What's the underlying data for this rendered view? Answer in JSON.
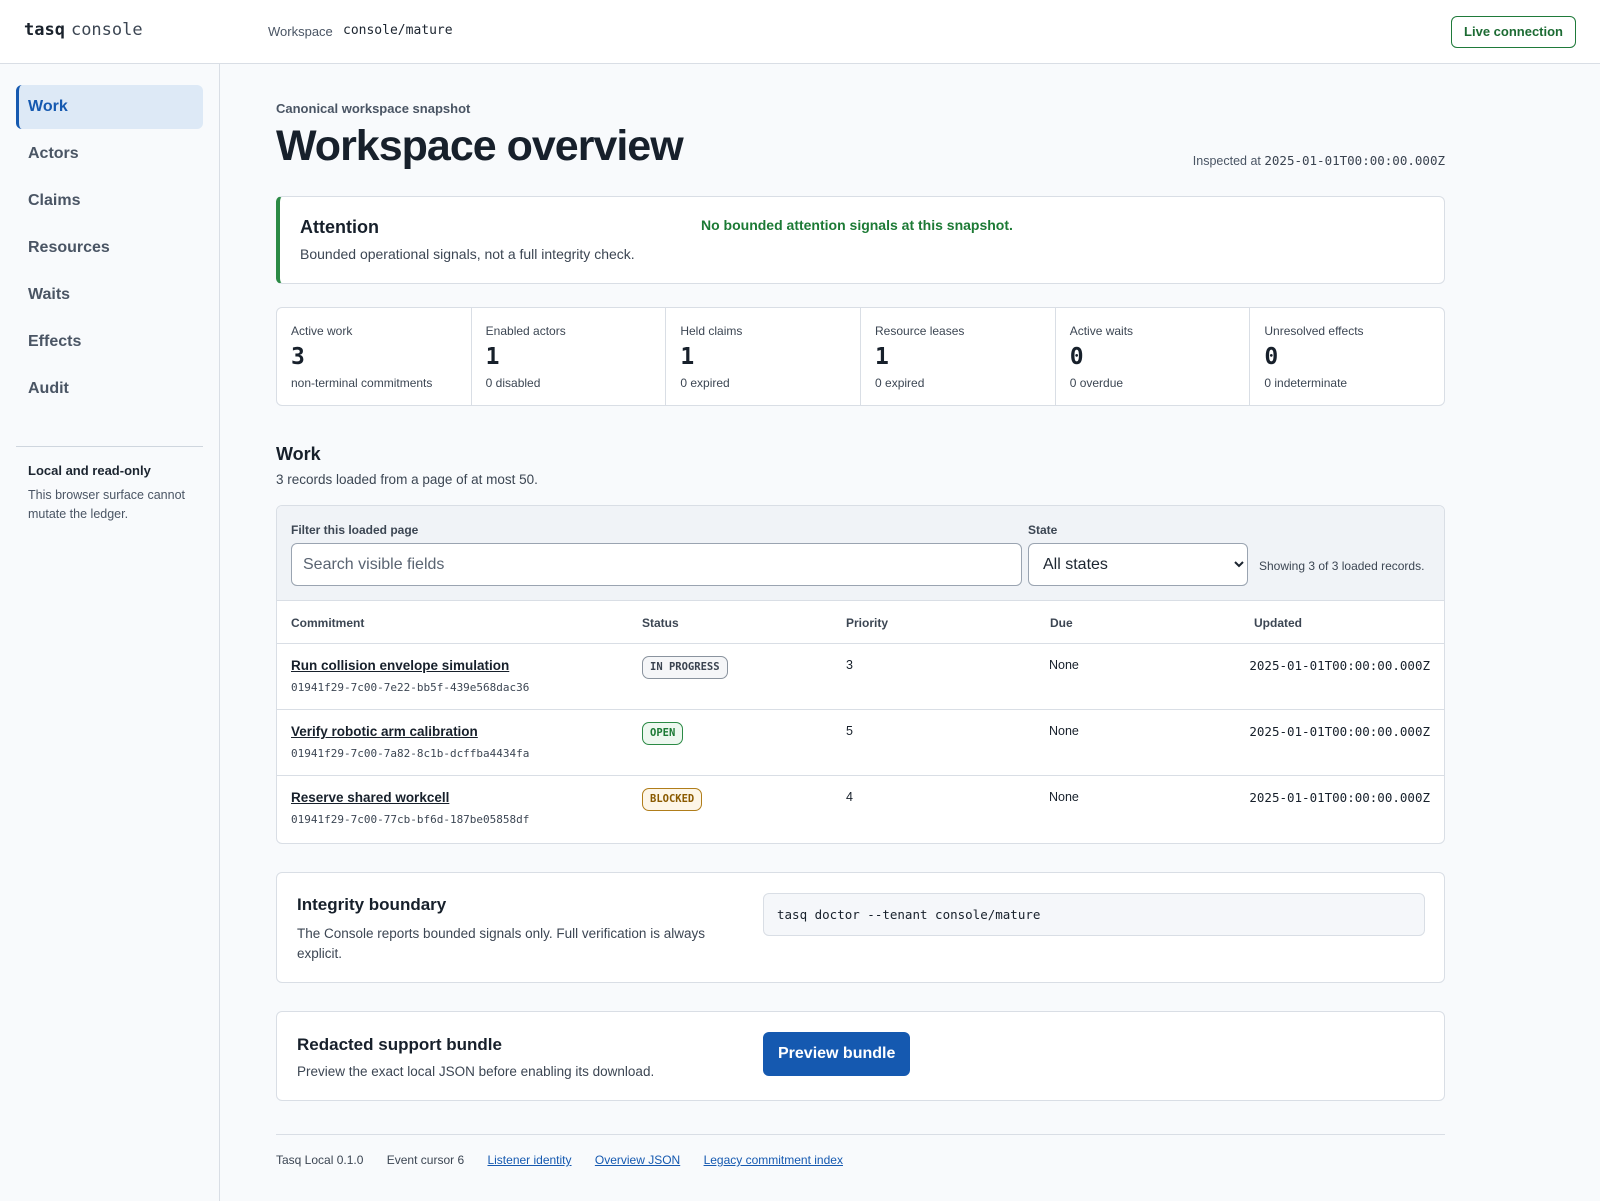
{
  "header": {
    "brand_bold": "tasq",
    "brand_rest": "console",
    "workspace_label": "Workspace",
    "workspace_value": "console/mature",
    "live_label": "Live connection"
  },
  "sidebar": {
    "items": [
      {
        "label": "Work",
        "active": true
      },
      {
        "label": "Actors"
      },
      {
        "label": "Claims"
      },
      {
        "label": "Resources"
      },
      {
        "label": "Waits"
      },
      {
        "label": "Effects"
      },
      {
        "label": "Audit"
      }
    ],
    "note_title": "Local and read-only",
    "note_text": "This browser surface cannot mutate the ledger."
  },
  "page": {
    "eyebrow": "Canonical workspace snapshot",
    "title": "Workspace overview",
    "inspected_label": "Inspected at",
    "inspected_value": "2025-01-01T00:00:00.000Z"
  },
  "attention": {
    "title": "Attention",
    "subtitle": "Bounded operational signals, not a full integrity check.",
    "status": "No bounded attention signals at this snapshot.",
    "accent_color": "#2b8a45"
  },
  "stats": [
    {
      "label": "Active work",
      "value": "3",
      "sub": "non-terminal commitments"
    },
    {
      "label": "Enabled actors",
      "value": "1",
      "sub": "0 disabled"
    },
    {
      "label": "Held claims",
      "value": "1",
      "sub": "0 expired"
    },
    {
      "label": "Resource leases",
      "value": "1",
      "sub": "0 expired"
    },
    {
      "label": "Active waits",
      "value": "0",
      "sub": "0 overdue"
    },
    {
      "label": "Unresolved effects",
      "value": "0",
      "sub": "0 indeterminate"
    }
  ],
  "work": {
    "title": "Work",
    "subtitle": "3 records loaded from a page of at most 50.",
    "filter_label": "Filter this loaded page",
    "search_placeholder": "Search visible fields",
    "state_label": "State",
    "state_selected": "All states",
    "showing": "Showing 3 of 3 loaded records.",
    "columns": {
      "commitment": "Commitment",
      "status": "Status",
      "priority": "Priority",
      "due": "Due",
      "updated": "Updated"
    },
    "rows": [
      {
        "title": "Run collision envelope simulation",
        "id": "01941f29-7c00-7e22-bb5f-439e568dac36",
        "status": "IN PROGRESS",
        "priority": "3",
        "due": "None",
        "updated": "2025-01-01T00:00:00.000Z"
      },
      {
        "title": "Verify robotic arm calibration",
        "id": "01941f29-7c00-7a82-8c1b-dcffba4434fa",
        "status": "OPEN",
        "priority": "5",
        "due": "None",
        "updated": "2025-01-01T00:00:00.000Z"
      },
      {
        "title": "Reserve shared workcell",
        "id": "01941f29-7c00-77cb-bf6d-187be05858df",
        "status": "BLOCKED",
        "priority": "4",
        "due": "None",
        "updated": "2025-01-01T00:00:00.000Z"
      }
    ]
  },
  "integrity": {
    "title": "Integrity boundary",
    "text": "The Console reports bounded signals only. Full verification is always explicit.",
    "command": "tasq doctor --tenant console/mature"
  },
  "bundle": {
    "title": "Redacted support bundle",
    "text": "Preview the exact local JSON before enabling its download.",
    "button_label": "Preview bundle",
    "button_color": "#1559b0"
  },
  "footer": {
    "version": "Tasq Local 0.1.0",
    "cursor": "Event cursor 6",
    "links": [
      "Listener identity",
      "Overview JSON",
      "Legacy commitment index"
    ]
  }
}
